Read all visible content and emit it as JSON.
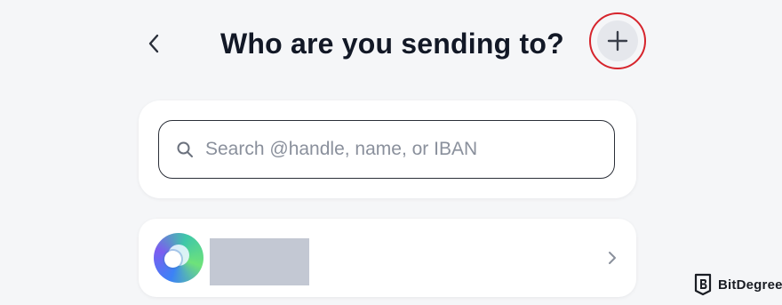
{
  "header": {
    "title": "Who are you sending to?",
    "back_icon": "chevron-left-icon",
    "add_icon": "plus-icon",
    "highlight_color": "#d6242c"
  },
  "search": {
    "placeholder": "Search @handle, name, or IBAN",
    "value": "",
    "icon": "search-icon"
  },
  "contacts": [
    {
      "avatar_icon": "avatar-logo",
      "name_redacted": true,
      "chevron_icon": "chevron-right-icon"
    }
  ],
  "watermark": {
    "text": "BitDegree",
    "icon": "bitdegree-logo-icon"
  }
}
